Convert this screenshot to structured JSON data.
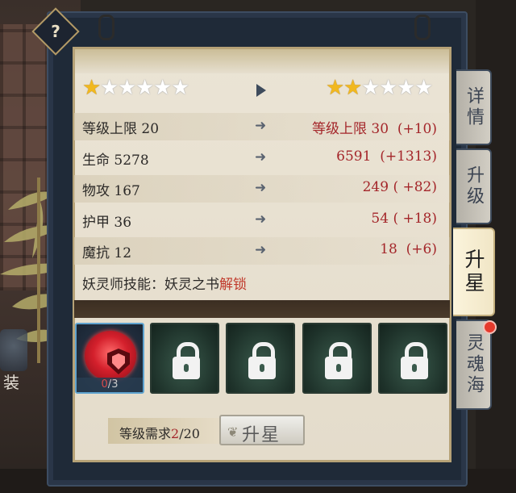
{
  "help_button": "?",
  "stars": {
    "current": {
      "filled": 1,
      "total": 6
    },
    "next": {
      "filled": 2,
      "total": 6
    }
  },
  "stats": [
    {
      "left": "等级上限  20",
      "right": "等级上限 30  (+10)"
    },
    {
      "left": "生命  5278",
      "right": "6591  (+1313)"
    },
    {
      "left": "物攻  167",
      "right": "249 ( +82)"
    },
    {
      "left": "护甲  36",
      "right": "54 ( +18)"
    },
    {
      "left": "魔抗  12",
      "right": "18  (+6)"
    }
  ],
  "skill": {
    "prefix": "妖灵师技能：妖灵之书",
    "unlock": "解锁"
  },
  "slots": {
    "first": {
      "owned": "0",
      "sep": "/",
      "need": "3"
    },
    "locked_count": 4
  },
  "requirement": {
    "label": "等级需求",
    "current": "2",
    "sep": "/",
    "max": "20"
  },
  "upgrade_button": "升星",
  "tabs": [
    "详情",
    "升级",
    "升星",
    "灵魂海"
  ],
  "side_label": "装",
  "colors": {
    "gold_star": "#f1b81f",
    "accent_red": "#a4262a",
    "slot_border_active": "#5fa3cf"
  }
}
